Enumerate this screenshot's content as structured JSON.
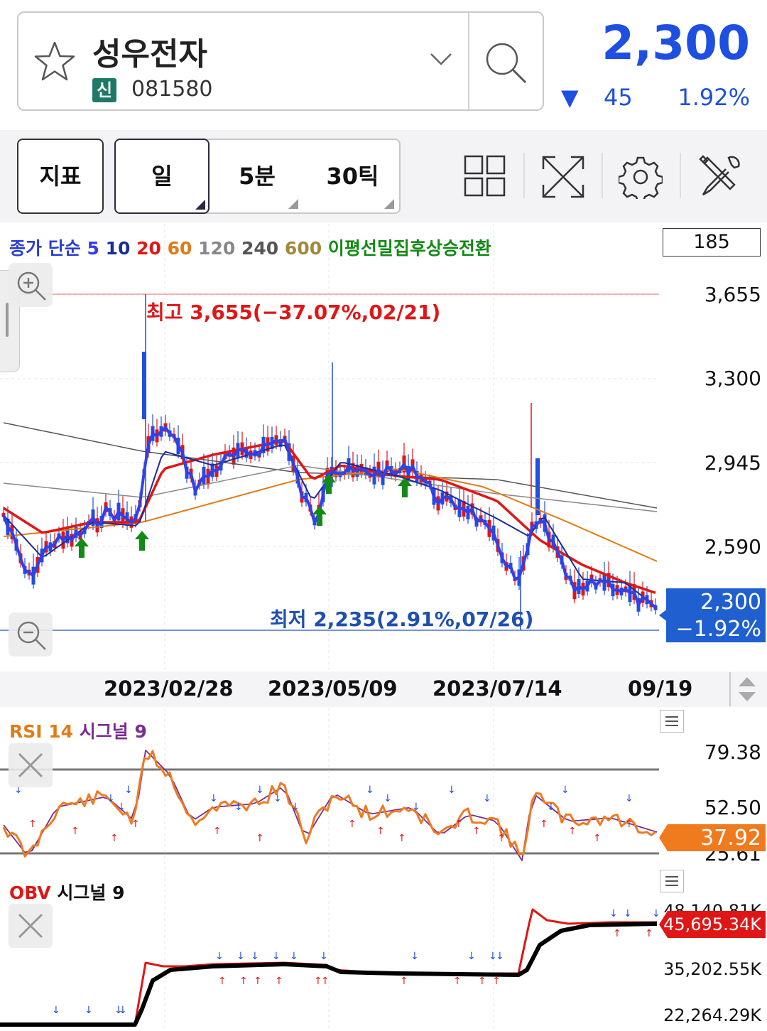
{
  "header": {
    "stock_name": "성우전자",
    "badge": "신",
    "code": "081580",
    "price": "2,300",
    "change_arrow": "▼",
    "change": "45",
    "change_pct": "1.92%",
    "accent_color": "#1f4fe0"
  },
  "toolbar": {
    "indicator_label": "지표",
    "tabs": [
      "일",
      "5분",
      "30틱"
    ],
    "icons": [
      "grid-icon",
      "expand-icon",
      "gear-icon",
      "tools-icon"
    ]
  },
  "main_chart": {
    "legend": {
      "prefix": "종가 단순",
      "ma5": "5",
      "ma10": "10",
      "ma20": "20",
      "ma60": "60",
      "ma120": "120",
      "ma240": "240",
      "ma600": "600",
      "signal": "이평선밀집후상승전환"
    },
    "count_box": "185",
    "high_label": "최고 3,655(−37.07%,02/21)",
    "low_label": "최저 2,235(2.91%,07/26)",
    "y_ticks": [
      "3,655",
      "3,300",
      "2,945",
      "2,590"
    ],
    "current_price": "2,300",
    "current_pct": "−1.92%"
  },
  "x_axis": {
    "dates": [
      "2023/02/28",
      "2023/05/09",
      "2023/07/14",
      "09/19"
    ]
  },
  "rsi": {
    "title_rsi": "RSI 14",
    "title_signal": "시그널 9",
    "y_ticks": [
      "79.38",
      "52.50",
      "25.61"
    ],
    "current": "37.92"
  },
  "obv": {
    "title_obv": "OBV",
    "title_signal": "시그널 9",
    "y_ticks": [
      "48,140.81K",
      "35,202.55K",
      "22,264.29K"
    ],
    "current": "45,695.34K"
  }
}
